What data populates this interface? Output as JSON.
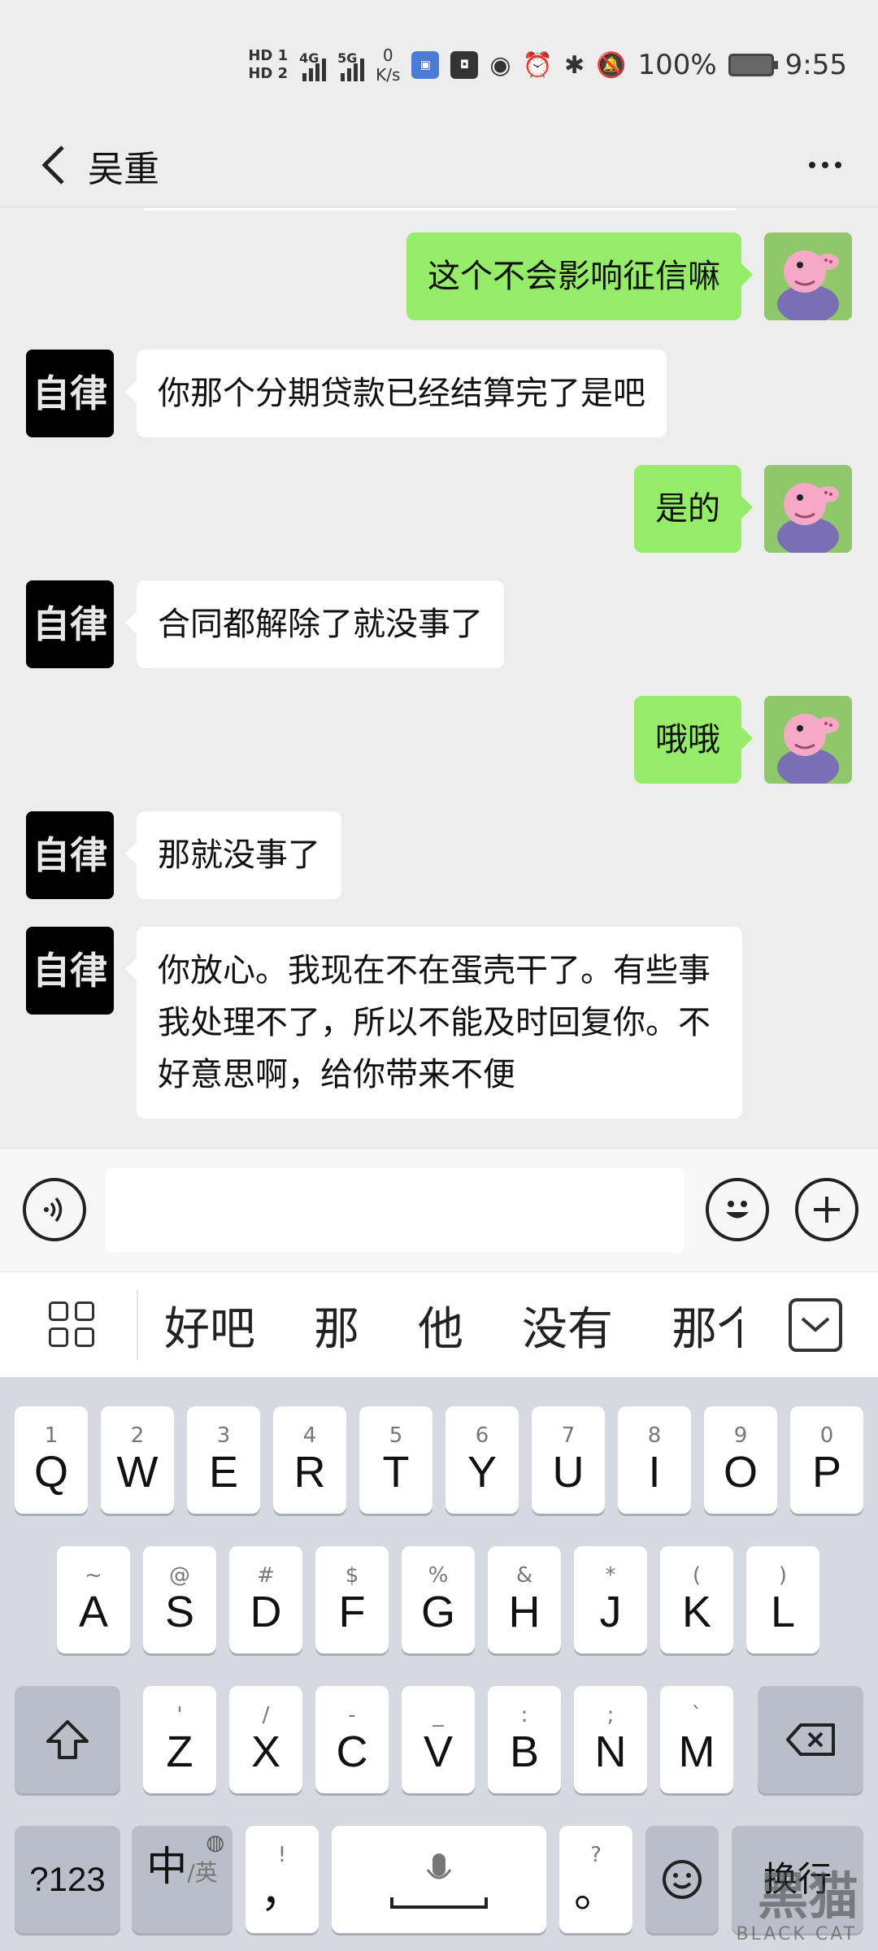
{
  "status_bar": {
    "hd_top": "HD 1",
    "hd_bottom": "HD 2",
    "net1": "4G",
    "net2": "5G",
    "speed_value": "0",
    "speed_unit": "K/s",
    "battery": "100%",
    "time": "9:55"
  },
  "header": {
    "title": "吴重",
    "back_icon": "chevron-left-icon",
    "more_icon": "more-dots-icon"
  },
  "messages": [
    {
      "side": "right",
      "text": "这个不会影响征信嘛"
    },
    {
      "side": "left",
      "text": "你那个分期贷款已经结算完了是吧"
    },
    {
      "side": "right",
      "text": "是的"
    },
    {
      "side": "left",
      "text": "合同都解除了就没事了"
    },
    {
      "side": "right",
      "text": "哦哦"
    },
    {
      "side": "left",
      "text": "那就没事了"
    },
    {
      "side": "left",
      "text": "你放心。我现在不在蛋壳干了。有些事我处理不了，所以不能及时回复你。不好意思啊，给你带来不便"
    }
  ],
  "avatars": {
    "left_text": "自律",
    "left_bg": "#000000",
    "right_bg": "#8fc86a"
  },
  "input_bar": {
    "voice_icon": "voice-icon",
    "emoji_icon": "emoji-icon",
    "plus_icon": "plus-icon",
    "value": ""
  },
  "suggestions": {
    "words": [
      "好吧",
      "那",
      "他",
      "没有",
      "那个"
    ],
    "grid_icon": "grid-icon",
    "collapse_icon": "chevron-down-icon"
  },
  "keyboard": {
    "row1": [
      {
        "main": "Q",
        "sub": "1"
      },
      {
        "main": "W",
        "sub": "2"
      },
      {
        "main": "E",
        "sub": "3"
      },
      {
        "main": "R",
        "sub": "4"
      },
      {
        "main": "T",
        "sub": "5"
      },
      {
        "main": "Y",
        "sub": "6"
      },
      {
        "main": "U",
        "sub": "7"
      },
      {
        "main": "I",
        "sub": "8"
      },
      {
        "main": "O",
        "sub": "9"
      },
      {
        "main": "P",
        "sub": "0"
      }
    ],
    "row2": [
      {
        "main": "A",
        "sub": "~"
      },
      {
        "main": "S",
        "sub": "@"
      },
      {
        "main": "D",
        "sub": "#"
      },
      {
        "main": "F",
        "sub": "$"
      },
      {
        "main": "G",
        "sub": "%"
      },
      {
        "main": "H",
        "sub": "&"
      },
      {
        "main": "J",
        "sub": "*"
      },
      {
        "main": "K",
        "sub": "("
      },
      {
        "main": "L",
        "sub": ")"
      }
    ],
    "row3": [
      {
        "main": "Z",
        "sub": "'"
      },
      {
        "main": "X",
        "sub": "/"
      },
      {
        "main": "C",
        "sub": "-"
      },
      {
        "main": "V",
        "sub": "_"
      },
      {
        "main": "B",
        "sub": ":"
      },
      {
        "main": "N",
        "sub": ";"
      },
      {
        "main": "M",
        "sub": "`"
      }
    ],
    "shift_icon": "shift-icon",
    "backspace_icon": "backspace-icon",
    "sym_label": "?123",
    "lang_main": "中",
    "lang_sub": "/英",
    "comma_main": "，",
    "comma_sub": "!",
    "period_main": "。",
    "period_sub": "?",
    "mic_icon": "mic-icon",
    "enter_label": "换行"
  },
  "watermark": {
    "cn": "黑猫",
    "en": "BLACK CAT"
  }
}
